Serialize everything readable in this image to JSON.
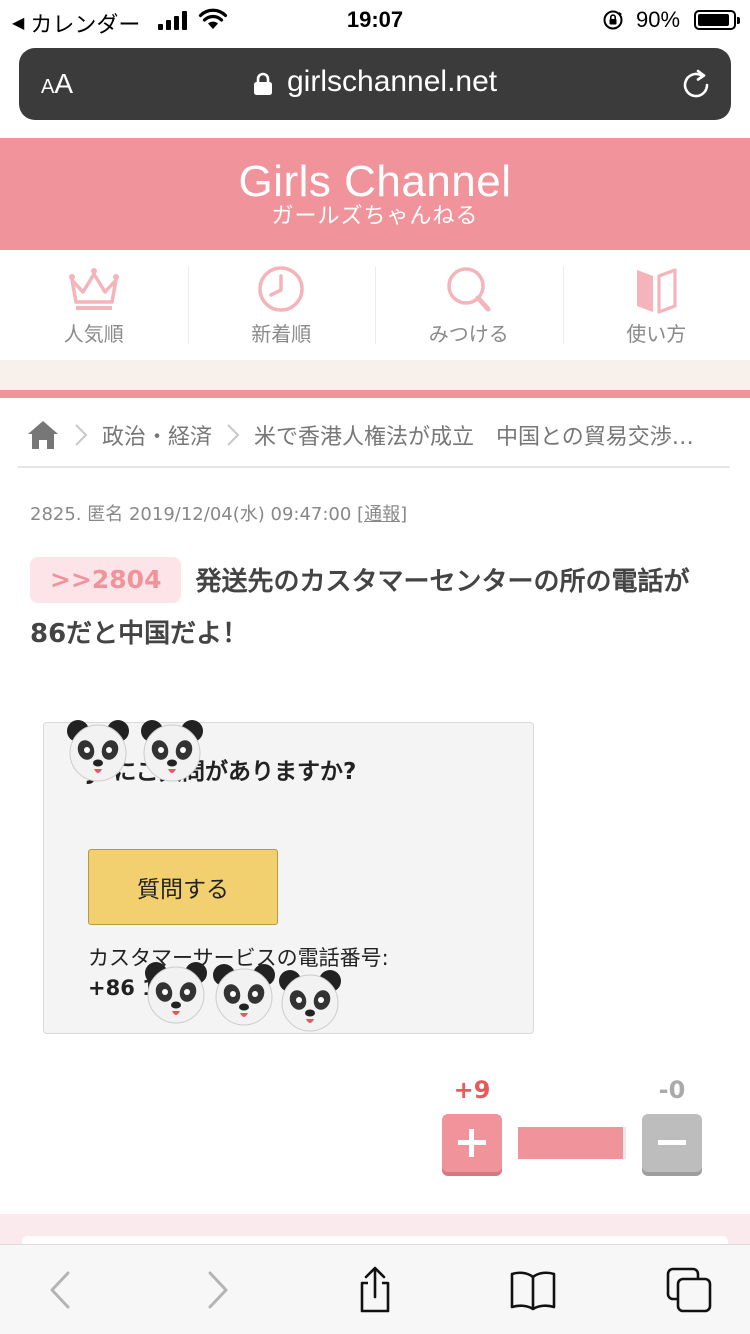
{
  "status_bar": {
    "back_app": "カレンダー",
    "time": "19:07",
    "battery_text": "90%",
    "battery_level": 0.9
  },
  "url_bar": {
    "aa_label_small": "A",
    "aa_label_large": "A",
    "url": "girlschannel.net"
  },
  "header": {
    "logo_en": "Girls Channel",
    "logo_jp": "ガールズちゃんねる"
  },
  "nav": [
    {
      "label": "人気順",
      "icon": "crown-icon"
    },
    {
      "label": "新着順",
      "icon": "clock-icon"
    },
    {
      "label": "みつける",
      "icon": "search-icon"
    },
    {
      "label": "使い方",
      "icon": "book-icon"
    }
  ],
  "breadcrumb": {
    "category": "政治・経済",
    "topic": "米で香港人権法が成立　中国との貿易交渉…"
  },
  "comment": {
    "meta_prefix": "2825. 匿名 2019/12/04(水) 09:47:00 [",
    "report_link": "通報",
    "meta_suffix": "]",
    "anchor": ">>2804",
    "text": "発送先のカスタマーセンターの所の電話が86だと中国だよ！"
  },
  "screenshot": {
    "title": "JPにご質問がありますか?",
    "button": "質問する",
    "service_label": "カスタマーサービスの電話番号:",
    "phone": "+86 1"
  },
  "votes": {
    "plus": "+9",
    "minus": "-0",
    "ratio": 0.97
  },
  "colors": {
    "brand_pink": "#f0939b",
    "anchor_bg": "#fce4e8",
    "plus_count": "#e85a5a"
  }
}
